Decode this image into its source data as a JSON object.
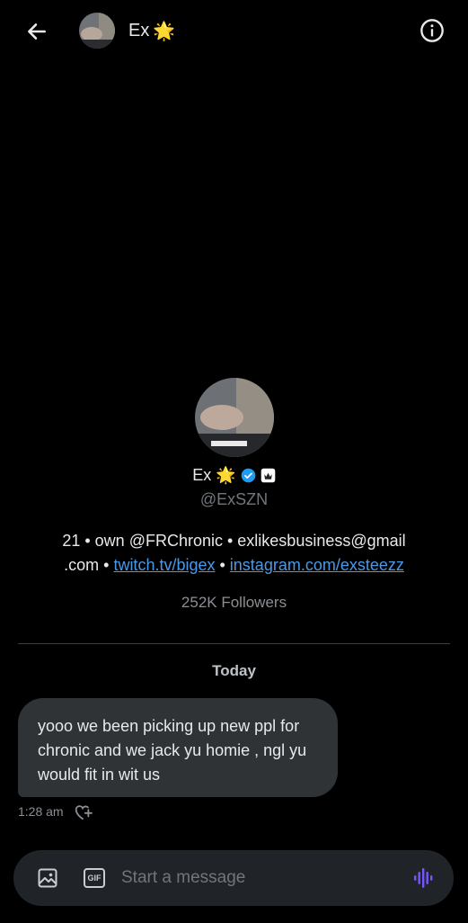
{
  "header": {
    "back_icon": "arrow-left-icon",
    "name": "Ex",
    "name_emoji": "🌟",
    "info_icon": "info-icon"
  },
  "profile": {
    "name": "Ex",
    "name_emoji": "🌟",
    "verified_color": "#1d9bf0",
    "handle": "@ExSZN",
    "bio_prefix": "21 • own @FRChronic • exlikesbusiness@gmail",
    "bio_line2_prefix": ".com • ",
    "bio_link1": "twitch.tv/bigex",
    "bio_sep": " • ",
    "bio_link2": "instagram.com/exsteezz",
    "followers": "252K Followers"
  },
  "conversation": {
    "day_label": "Today",
    "messages": [
      {
        "text": "yooo we been picking up new ppl for chronic and we jack yu homie , ngl yu would fit in wit us",
        "time": "1:28 am"
      }
    ]
  },
  "composer": {
    "placeholder": "Start a message",
    "gif_label": "GIF",
    "accent": "#7856ff"
  }
}
